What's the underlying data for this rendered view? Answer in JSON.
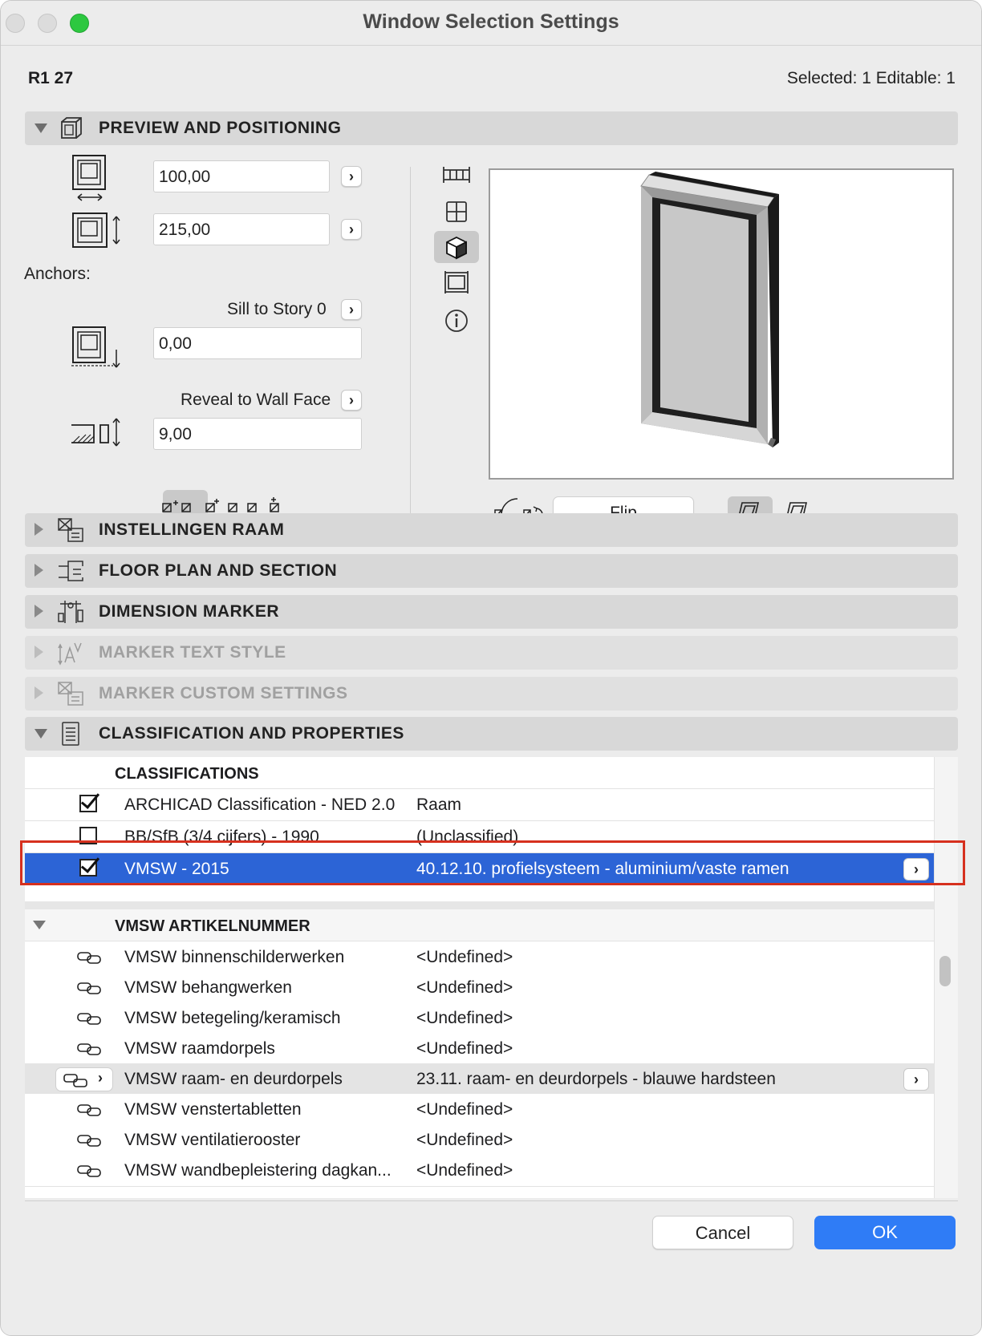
{
  "window": {
    "title": "Window Selection Settings"
  },
  "header": {
    "element_id": "R1 27",
    "selection_info": "Selected: 1 Editable: 1"
  },
  "sections": {
    "preview": "PREVIEW AND POSITIONING",
    "raam": "INSTELLINGEN RAAM",
    "floorplan": "FLOOR PLAN AND SECTION",
    "dimension": "DIMENSION MARKER",
    "marker_text": "MARKER TEXT STYLE",
    "marker_custom": "MARKER CUSTOM SETTINGS",
    "classification": "CLASSIFICATION AND PROPERTIES"
  },
  "positioning": {
    "width": "100,00",
    "height": "215,00",
    "anchors_label": "Anchors:",
    "sill_label": "Sill to Story 0",
    "sill_value": "0,00",
    "reveal_label": "Reveal to Wall Face",
    "reveal_value": "9,00",
    "flip_label": "Flip"
  },
  "classifications": {
    "header": "CLASSIFICATIONS",
    "rows": [
      {
        "system": "ARCHICAD Classification - NED 2.0",
        "value": "Raam",
        "checked": true
      },
      {
        "system": "BB/SfB (3/4 cijfers) - 1990",
        "value": "(Unclassified)",
        "checked": false
      },
      {
        "system": "VMSW - 2015",
        "value": "40.12.10. profielsysteem - aluminium/vaste ramen",
        "checked": true
      }
    ]
  },
  "properties": {
    "group": "VMSW ARTIKELNUMMER",
    "rows": [
      {
        "name": "VMSW binnenschilderwerken",
        "value": "<Undefined>"
      },
      {
        "name": "VMSW behangwerken",
        "value": "<Undefined>"
      },
      {
        "name": "VMSW betegeling/keramisch",
        "value": "<Undefined>"
      },
      {
        "name": "VMSW raamdorpels",
        "value": "<Undefined>"
      },
      {
        "name": "VMSW raam- en deurdorpels",
        "value": "23.11. raam- en deurdorpels - blauwe hardsteen"
      },
      {
        "name": "VMSW venstertabletten",
        "value": "<Undefined>"
      },
      {
        "name": "VMSW ventilatierooster",
        "value": "<Undefined>"
      },
      {
        "name": "VMSW wandbepleistering dagkan...",
        "value": "<Undefined>"
      }
    ]
  },
  "buttons": {
    "cancel": "Cancel",
    "ok": "OK"
  },
  "colors": {
    "selection": "#2c64d6",
    "ok": "#2f7cf6",
    "highlight_box": "#d6301e",
    "zoom": "#2dc840"
  }
}
